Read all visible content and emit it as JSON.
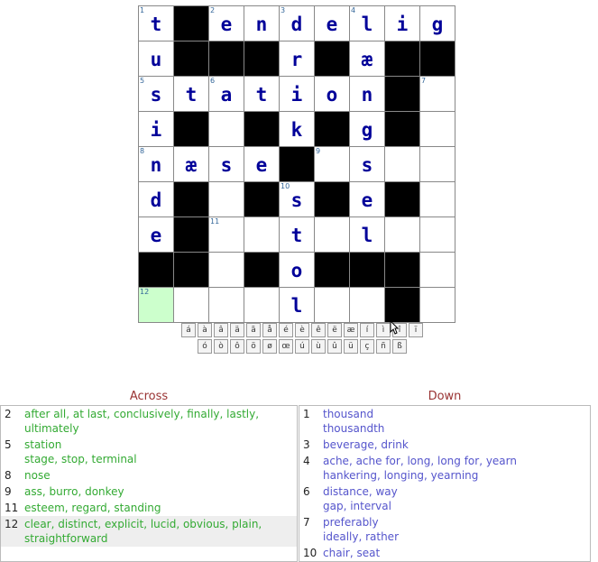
{
  "grid": {
    "rows": [
      [
        {
          "n": "1",
          "l": "t"
        },
        {
          "b": true
        },
        {
          "n": "2",
          "l": "e"
        },
        {
          "l": "n"
        },
        {
          "n": "3",
          "l": "d"
        },
        {
          "l": "e"
        },
        {
          "n": "4",
          "l": "l"
        },
        {
          "l": "i"
        },
        {
          "l": "g"
        }
      ],
      [
        {
          "l": "u"
        },
        {
          "b": true
        },
        {
          "b": true
        },
        {
          "b": true
        },
        {
          "l": "r"
        },
        {
          "b": true
        },
        {
          "l": "æ"
        },
        {
          "b": true
        },
        {
          "b": true
        }
      ],
      [
        {
          "n": "5",
          "l": "s"
        },
        {
          "l": "t"
        },
        {
          "n": "6",
          "l": "a"
        },
        {
          "l": "t"
        },
        {
          "l": "i"
        },
        {
          "l": "o"
        },
        {
          "l": "n"
        },
        {
          "b": true
        },
        {
          "n": "7"
        }
      ],
      [
        {
          "l": "i"
        },
        {
          "b": true
        },
        {},
        {
          "b": true
        },
        {
          "l": "k"
        },
        {
          "b": true
        },
        {
          "l": "g"
        },
        {
          "b": true
        },
        {}
      ],
      [
        {
          "n": "8",
          "l": "n"
        },
        {
          "l": "æ"
        },
        {
          "l": "s"
        },
        {
          "l": "e"
        },
        {
          "b": true
        },
        {
          "n": "9"
        },
        {
          "l": "s"
        },
        {},
        {}
      ],
      [
        {
          "l": "d"
        },
        {
          "b": true
        },
        {},
        {
          "b": true
        },
        {
          "n": "10",
          "l": "s"
        },
        {
          "b": true
        },
        {
          "l": "e"
        },
        {
          "b": true
        },
        {}
      ],
      [
        {
          "l": "e"
        },
        {
          "b": true
        },
        {
          "n": "11"
        },
        {},
        {
          "l": "t"
        },
        {},
        {
          "l": "l"
        },
        {},
        {}
      ],
      [
        {
          "b": true
        },
        {
          "b": true
        },
        {},
        {
          "b": true
        },
        {
          "l": "o"
        },
        {
          "b": true
        },
        {
          "b": true
        },
        {
          "b": true
        },
        {}
      ],
      [
        {
          "n": "12",
          "sel": true
        },
        {},
        {},
        {},
        {
          "l": "l"
        },
        {},
        {},
        {
          "b": true
        },
        {}
      ]
    ]
  },
  "special_chars": {
    "row1": [
      "á",
      "à",
      "â",
      "ä",
      "ã",
      "å",
      "é",
      "è",
      "ê",
      "ë",
      "æ",
      "í",
      "ì",
      "î",
      "ï"
    ],
    "row2": [
      "ó",
      "ò",
      "ô",
      "ö",
      "ø",
      "œ",
      "ú",
      "ù",
      "û",
      "ü",
      "ç",
      "ñ",
      "ß"
    ]
  },
  "across": {
    "heading": "Across",
    "clues": [
      {
        "num": "2",
        "lines": [
          "after all, at last, conclusively, finally, lastly,",
          "ultimately"
        ]
      },
      {
        "num": "5",
        "lines": [
          "station",
          "stage, stop, terminal"
        ]
      },
      {
        "num": "8",
        "lines": [
          "nose"
        ]
      },
      {
        "num": "9",
        "lines": [
          "ass, burro, donkey"
        ]
      },
      {
        "num": "11",
        "lines": [
          "esteem, regard, standing"
        ]
      },
      {
        "num": "12",
        "lines": [
          "clear, distinct, explicit, lucid, obvious, plain,",
          "straightforward"
        ],
        "highlight": true
      }
    ]
  },
  "down": {
    "heading": "Down",
    "clues": [
      {
        "num": "1",
        "lines": [
          "thousand",
          "thousandth"
        ]
      },
      {
        "num": "3",
        "lines": [
          "beverage, drink"
        ]
      },
      {
        "num": "4",
        "lines": [
          "ache, ache for, long, long for, yearn",
          "hankering, longing, yearning"
        ]
      },
      {
        "num": "6",
        "lines": [
          "distance, way",
          "gap, interval"
        ]
      },
      {
        "num": "7",
        "lines": [
          "preferably",
          "ideally, rather"
        ]
      },
      {
        "num": "10",
        "lines": [
          "chair, seat"
        ]
      }
    ]
  }
}
